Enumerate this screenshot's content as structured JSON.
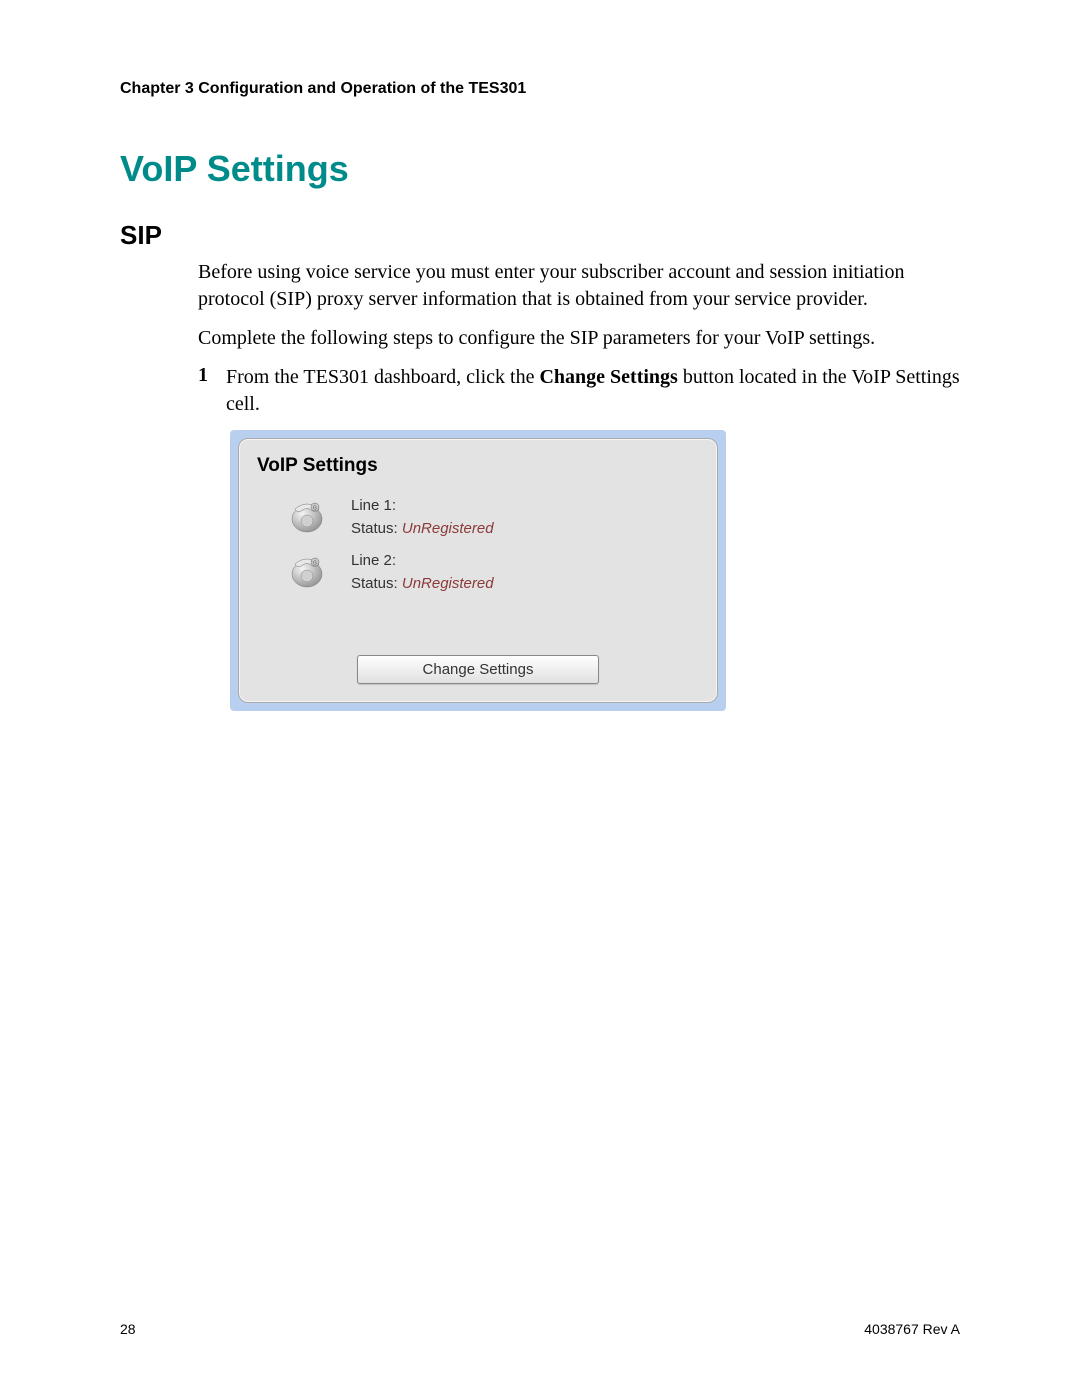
{
  "chapter_header": "Chapter 3    Configuration and Operation of the TES301",
  "section_title": "VoIP Settings",
  "subsection_title": "SIP",
  "intro_paragraph": "Before using voice service you must enter your subscriber account and session initiation protocol (SIP) proxy server information that is obtained from your service provider.",
  "instruction_paragraph": "Complete the following steps to configure the SIP parameters for your VoIP settings.",
  "step": {
    "number": "1",
    "prefix": "From the TES301 dashboard, click the ",
    "bold": "Change Settings",
    "suffix": " button located in the VoIP Settings cell."
  },
  "panel": {
    "title": "VoIP Settings",
    "lines": [
      {
        "label": "Line 1:",
        "status_label": "Status: ",
        "status_value": "UnRegistered"
      },
      {
        "label": "Line 2:",
        "status_label": "Status: ",
        "status_value": "UnRegistered"
      }
    ],
    "button_label": "Change Settings"
  },
  "footer": {
    "page_number": "28",
    "doc_id": "4038767 Rev A"
  }
}
